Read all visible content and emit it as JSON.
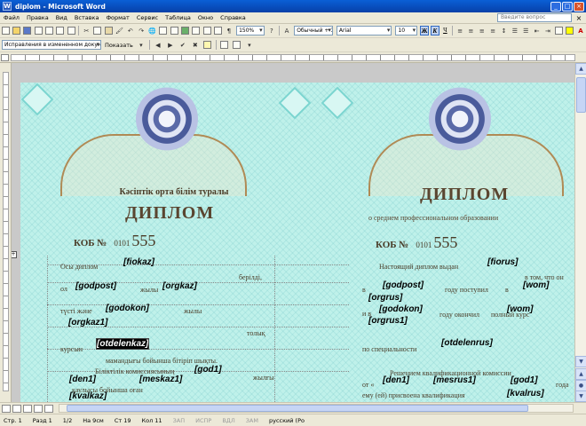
{
  "window": {
    "title": "diplom - Microsoft Word",
    "minimize": "_",
    "maximize": "□",
    "close": "×"
  },
  "menu": {
    "items": [
      "Файл",
      "Правка",
      "Вид",
      "Вставка",
      "Формат",
      "Сервис",
      "Таблица",
      "Окно",
      "Справка"
    ],
    "help_placeholder": "Введите вопрос",
    "close_doc": "×"
  },
  "toolbar": {
    "zoom": "150%",
    "style": "Обычный + 10 п",
    "font": "Arial",
    "size": "10",
    "bold": "Ж",
    "italic": "К",
    "underline": "Ч"
  },
  "review": {
    "mode": "Исправления в измененном документ",
    "show": "Показать"
  },
  "document": {
    "left": {
      "title": "Кәсіптік орта білім туралы",
      "heading": "ДИПЛОМ",
      "kob": "КОБ №",
      "number": "0101",
      "number_big": "555",
      "lines": [
        "Осы диплом",
        "берілді,",
        "ол",
        "жылы",
        "түсті және",
        "жылы",
        "толық",
        "курсын",
        "мамандығы бойынша бітіріп шықты.",
        "Біліктілік комиссиясының",
        "жылғы",
        "қаулысы бойынша оған",
        "біліктілігі берілді."
      ],
      "fields": {
        "fiokaz": "[fiokaz]",
        "godpost": "[godpost]",
        "orgkaz": "[orgkaz]",
        "godokon": "[godokon]",
        "orgkaz1": "[orgkaz1]",
        "otdelenkaz": "[otdelenkaz]",
        "god1": "[god1]",
        "den1": "[den1]",
        "meskaz1": "[meskaz1]",
        "kvalkaz": "[kvalkaz]"
      }
    },
    "right": {
      "heading": "ДИПЛОМ",
      "subtitle": "о среднем профессиональном образовании",
      "kob": "КОБ №",
      "number": "0101",
      "number_big": "555",
      "lines": [
        "Настоящий диплом выдан",
        "в том, что он",
        "в",
        "году поступил",
        "в",
        "и в",
        "году окончил",
        "полный курс",
        "по специальности",
        "Решением квалификационной комиссии",
        "от «",
        "»",
        "года",
        "ему (ей) присвоена квалификация"
      ],
      "fields": {
        "fiorus": "[fiorus]",
        "godpost": "[godpost]",
        "wom": "[wom]",
        "orgrus": "[orgrus]",
        "godokon": "[godokon]",
        "wom2": "[wom]",
        "orgrus1": "[orgrus1]",
        "otdelenrus": "[otdelenrus]",
        "den1": "[den1]",
        "mesrus1": "[mesrus1]",
        "god1": "[god1]",
        "kvalrus": "[kvalrus]"
      }
    }
  },
  "status": {
    "page": "Стр. 1",
    "section": "Разд 1",
    "pages": "1/2",
    "at": "На 9см",
    "line": "Ст 19",
    "col": "Кол 11",
    "rec": "ЗАП",
    "trk": "ИСПР",
    "ext": "ВДЛ",
    "ovr": "ЗАМ",
    "lang": "русский (Ро"
  }
}
